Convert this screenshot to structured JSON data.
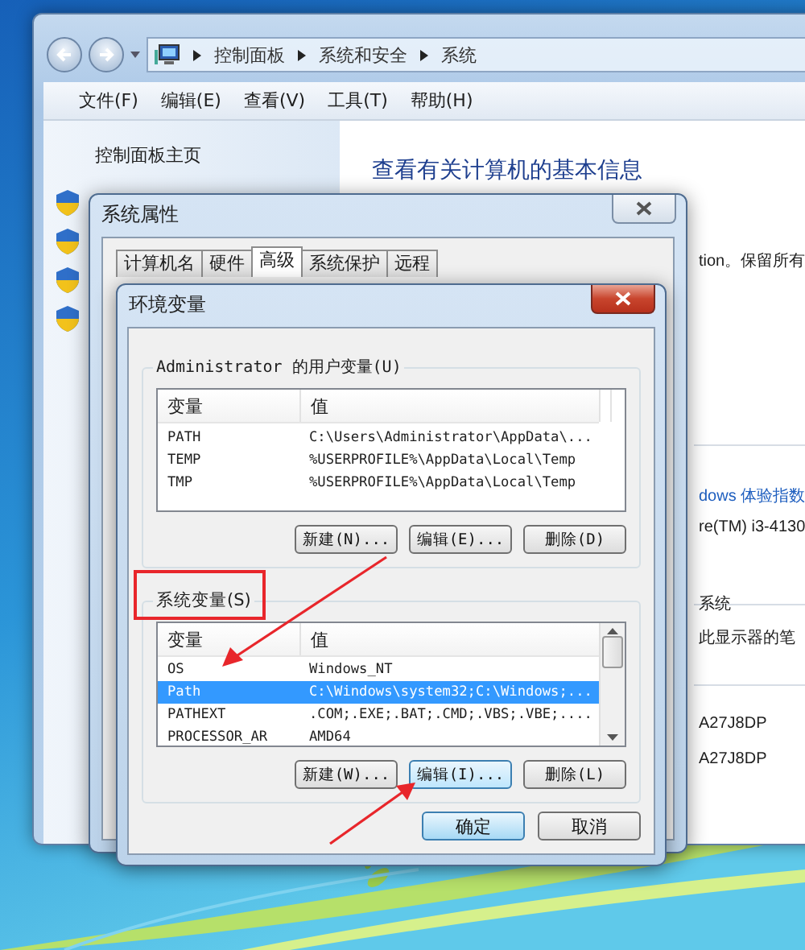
{
  "explorer": {
    "breadcrumb": [
      "控制面板",
      "系统和安全",
      "系统"
    ],
    "menu": [
      "文件(F)",
      "编辑(E)",
      "查看(V)",
      "工具(T)",
      "帮助(H)"
    ],
    "sidebar": {
      "home": "控制面板主页"
    },
    "content": {
      "heading": "查看有关计算机的基本信息",
      "fragments": [
        {
          "text": "tion。保留所有",
          "kind": "plain"
        },
        {
          "text": "dows 体验指数",
          "kind": "link"
        },
        {
          "text": "re(TM) i3-4130",
          "kind": "plain"
        },
        {
          "text": "系统",
          "kind": "plain"
        },
        {
          "text": "此显示器的笔",
          "kind": "plain"
        },
        {
          "text": "A27J8DP",
          "kind": "plain"
        },
        {
          "text": "A27J8DP",
          "kind": "plain"
        }
      ]
    }
  },
  "system_properties": {
    "title": "系统属性",
    "tabs": [
      {
        "label": "计算机名",
        "selected": false
      },
      {
        "label": "硬件",
        "selected": false
      },
      {
        "label": "高级",
        "selected": true
      },
      {
        "label": "系统保护",
        "selected": false
      },
      {
        "label": "远程",
        "selected": false
      }
    ]
  },
  "environment_dialog": {
    "title": "环境变量",
    "user_variables": {
      "label": "Administrator 的用户变量(U)",
      "columns": [
        "变量",
        "值"
      ],
      "rows": [
        {
          "name": "PATH",
          "value": "C:\\Users\\Administrator\\AppData\\...",
          "selected": false
        },
        {
          "name": "TEMP",
          "value": "%USERPROFILE%\\AppData\\Local\\Temp",
          "selected": false
        },
        {
          "name": "TMP",
          "value": "%USERPROFILE%\\AppData\\Local\\Temp",
          "selected": false
        }
      ],
      "buttons": [
        {
          "label": "新建(N)...",
          "focused": false
        },
        {
          "label": "编辑(E)...",
          "focused": false
        },
        {
          "label": "删除(D)",
          "focused": false
        }
      ]
    },
    "system_variables": {
      "label": "系统变量(S)",
      "columns": [
        "变量",
        "值"
      ],
      "rows": [
        {
          "name": "OS",
          "value": "Windows_NT",
          "selected": false
        },
        {
          "name": "Path",
          "value": "C:\\Windows\\system32;C:\\Windows;...",
          "selected": true
        },
        {
          "name": "PATHEXT",
          "value": ".COM;.EXE;.BAT;.CMD;.VBS;.VBE;....",
          "selected": false
        },
        {
          "name": "PROCESSOR_AR",
          "value": "AMD64",
          "selected": false
        }
      ],
      "buttons": [
        {
          "label": "新建(W)...",
          "focused": false
        },
        {
          "label": "编辑(I)...",
          "focused": true
        },
        {
          "label": "删除(L)",
          "focused": false
        }
      ]
    },
    "buttons": [
      {
        "label": "确定",
        "default": true
      },
      {
        "label": "取消",
        "default": false
      }
    ]
  }
}
